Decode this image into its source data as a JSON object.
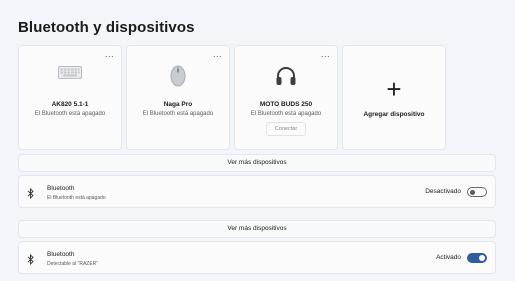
{
  "page": {
    "title": "Bluetooth y dispositivos"
  },
  "devices": [
    {
      "name": "AK820 5.1-1",
      "status": "El Bluetooth está apagado",
      "icon": "keyboard-icon",
      "more": "..."
    },
    {
      "name": "Naga Pro",
      "status": "El Bluetooth está apagado",
      "icon": "mouse-icon",
      "more": "..."
    },
    {
      "name": "MOTO BUDS 250",
      "status": "El Bluetooth está apagado",
      "icon": "headphones-icon",
      "more": "...",
      "button": "Conectar"
    }
  ],
  "add_device": {
    "label": "Agregar dispositivo",
    "icon": "plus-icon"
  },
  "more_devices_1": "Ver más dispositivos",
  "bluetooth_off": {
    "title": "Bluetooth",
    "subtitle": "El Bluetooth está apagado",
    "state": "Desactivado",
    "toggle_on": false
  },
  "more_devices_2": "Ver más dispositivos",
  "bluetooth_on": {
    "title": "Bluetooth",
    "subtitle": "Detectable al \"RAZER\"",
    "state": "Activado",
    "toggle_on": true
  },
  "colors": {
    "accent": "#315b9f",
    "background": "#f2f5f9",
    "card": "#fbfbfb"
  }
}
